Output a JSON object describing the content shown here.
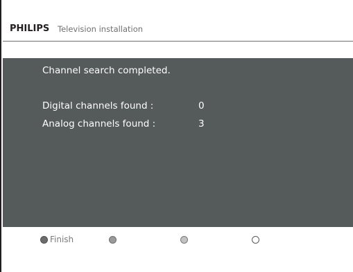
{
  "header": {
    "brand": "PHILIPS",
    "title": "Television installation"
  },
  "panel": {
    "message": "Channel search completed.",
    "rows": [
      {
        "label": "Digital channels found :",
        "value": "0"
      },
      {
        "label": "Analog channels found :",
        "value": "3"
      }
    ]
  },
  "footer": {
    "buttons": [
      {
        "label": "Finish",
        "icon": "red-key-icon",
        "color": "#6c6c6c"
      },
      {
        "label": "",
        "icon": "green-key-icon",
        "color": "#9a9a9a"
      },
      {
        "label": "",
        "icon": "yellow-key-icon",
        "color": "#c2c2c2"
      },
      {
        "label": "",
        "icon": "blue-key-icon",
        "color": "#ffffff"
      }
    ]
  }
}
